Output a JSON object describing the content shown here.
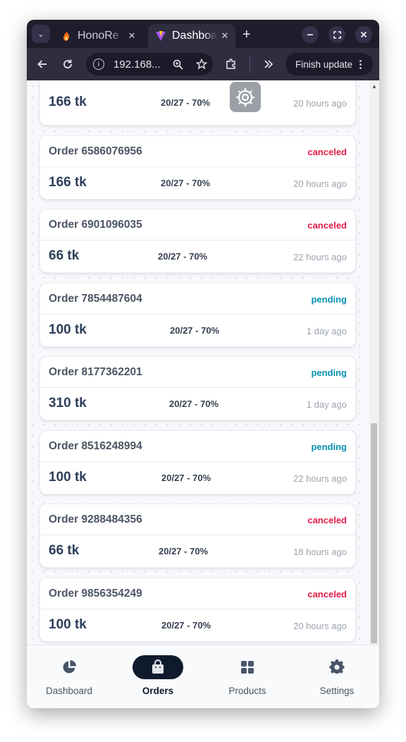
{
  "browser": {
    "tabs": [
      {
        "title": "HonoRe"
      },
      {
        "title": "Dashboa"
      }
    ],
    "tab_close_glyph": "✕",
    "new_tab_glyph": "+",
    "url": "192.168...",
    "finish_update_label": "Finish update",
    "icons": [
      "tab-list-icon",
      "flame-favicon",
      "vite-favicon",
      "minimize-icon",
      "restore-icon",
      "close-window-icon",
      "back-icon",
      "reload-icon",
      "site-info-icon",
      "zoom-icon",
      "bookmark-star-icon",
      "extensions-icon",
      "overflow-chevron-icon",
      "menu-dots-icon"
    ]
  },
  "orders": [
    {
      "id": "",
      "amount": "166 tk",
      "rate": "20/27 - 70%",
      "time": "20 hours ago",
      "status": ""
    },
    {
      "id": "Order 6586076956",
      "amount": "166 tk",
      "rate": "20/27 - 70%",
      "time": "20 hours ago",
      "status": "canceled"
    },
    {
      "id": "Order 6901096035",
      "amount": "66 tk",
      "rate": "20/27 - 70%",
      "time": "22 hours ago",
      "status": "canceled"
    },
    {
      "id": "Order 7854487604",
      "amount": "100 tk",
      "rate": "20/27 - 70%",
      "time": "1 day ago",
      "status": "pending"
    },
    {
      "id": "Order 8177362201",
      "amount": "310 tk",
      "rate": "20/27 - 70%",
      "time": "1 day ago",
      "status": "pending"
    },
    {
      "id": "Order 8516248994",
      "amount": "100 tk",
      "rate": "20/27 - 70%",
      "time": "22 hours ago",
      "status": "pending"
    },
    {
      "id": "Order 9288484356",
      "amount": "66 tk",
      "rate": "20/27 - 70%",
      "time": "18 hours ago",
      "status": "canceled"
    },
    {
      "id": "Order 9856354249",
      "amount": "100 tk",
      "rate": "20/27 - 70%",
      "time": "20 hours ago",
      "status": "canceled"
    }
  ],
  "status_colors": {
    "canceled": "#e11d48",
    "pending": "#0891b2"
  },
  "nav": {
    "items": [
      {
        "label": "Dashboard",
        "icon": "pie-chart-icon",
        "active": false
      },
      {
        "label": "Orders",
        "icon": "shopping-bag-icon",
        "active": true
      },
      {
        "label": "Products",
        "icon": "grid-icon",
        "active": false
      },
      {
        "label": "Settings",
        "icon": "gear-icon",
        "active": false
      }
    ]
  }
}
